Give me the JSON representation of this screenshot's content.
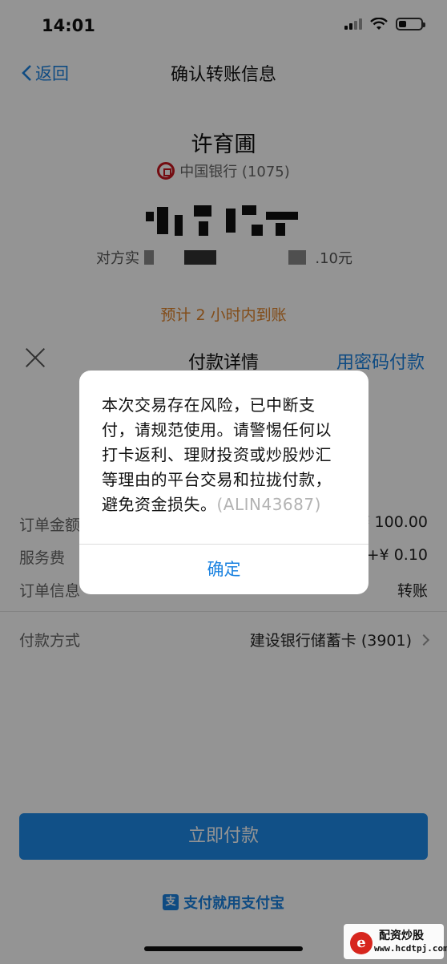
{
  "status_bar": {
    "time": "14:01",
    "battery_level": 0.35
  },
  "nav": {
    "back_label": "返回",
    "title": "确认转账信息"
  },
  "payee": {
    "name": "许育圃",
    "bank": "中国银行 (1075)",
    "received_prefix": "对方实",
    "received_suffix": ".10元",
    "eta": "预计 2 小时内到账"
  },
  "sheet": {
    "title": "付款详情",
    "password_pay_label": "用密码付款",
    "rows": [
      {
        "label": "订单金额",
        "value": "¥ 100.00"
      },
      {
        "label": "服务费",
        "value": "+¥ 0.10"
      },
      {
        "label": "订单信息",
        "value": "转账"
      }
    ],
    "payment_method": {
      "label": "付款方式",
      "value": "建设银行储蓄卡 (3901)"
    },
    "pay_button": "立即付款",
    "slogan": "支付就用支付宝"
  },
  "dialog": {
    "message": "本次交易存在风险，已中断支付，请规范使用。请警惕任何以打卡返利、理财投资或炒股炒汇等理由的平台交易和拉拢付款，避免资金损失。",
    "code": "(ALIN43687)",
    "ok_label": "确定"
  },
  "watermark": {
    "title": "配资炒股",
    "url": "www.hcdtpj.com",
    "logo_letter": "e"
  },
  "colors": {
    "accent": "#1a82e0",
    "eta": "#e0832a",
    "button": "#1e8be8",
    "overlay": "rgba(0,0,0,0.42)"
  }
}
